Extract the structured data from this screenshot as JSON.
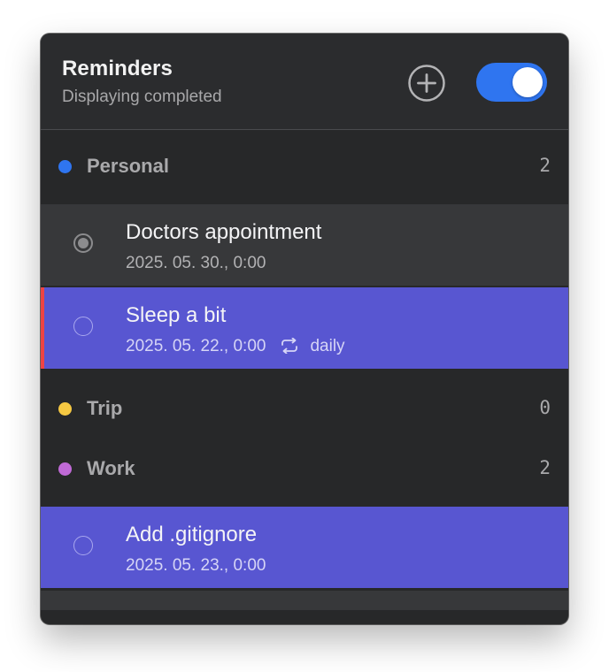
{
  "header": {
    "title": "Reminders",
    "subtitle": "Displaying completed",
    "add_icon": "plus-circle-icon",
    "show_completed_toggle": {
      "on": true,
      "color": "#2f75f0"
    }
  },
  "lists": [
    {
      "name": "Personal",
      "count": "2",
      "color": "#2f75f0",
      "items": [
        {
          "title": "Doctors appointment",
          "date": "2025. 05. 30., 0:00",
          "completed": true
        },
        {
          "title": "Sleep a bit",
          "date": "2025. 05. 22., 0:00",
          "repeat_icon": "repeat-icon",
          "repeat": "daily",
          "completed": false
        }
      ]
    },
    {
      "name": "Trip",
      "count": "0",
      "color": "#f5c842",
      "items": []
    },
    {
      "name": "Work",
      "count": "2",
      "color": "#c06ad6",
      "items": [
        {
          "title": "Add .gitignore",
          "date": "2025. 05. 23., 0:00",
          "completed": false
        }
      ]
    }
  ],
  "colors": {
    "background": "#272829",
    "selected_row": "#5856d1",
    "completed_row": "#37383a",
    "priority_marker": "#ee4444"
  }
}
